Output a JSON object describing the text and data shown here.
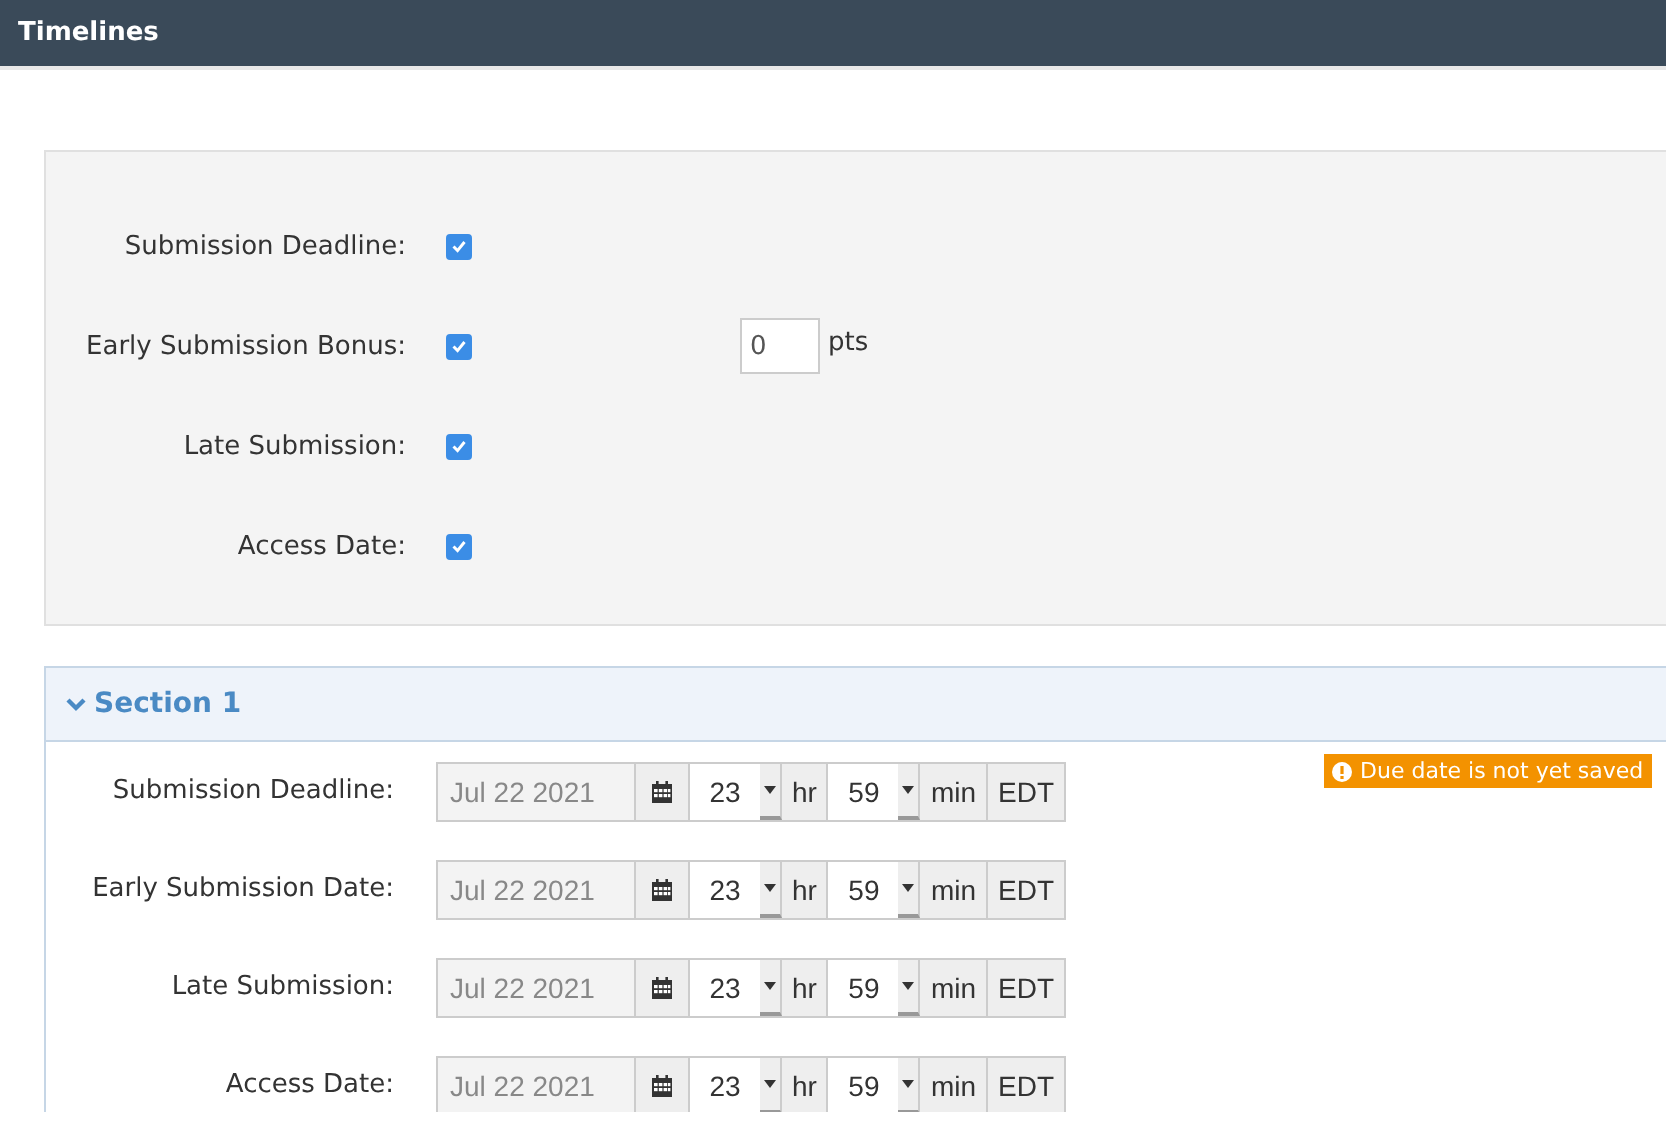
{
  "header": {
    "title": "Timelines"
  },
  "settings": [
    {
      "label": "Submission Deadline:",
      "checked": true
    },
    {
      "label": "Early Submission Bonus:",
      "checked": true,
      "bonus": {
        "value": "0",
        "unit": "pts"
      }
    },
    {
      "label": "Late Submission:",
      "checked": true
    },
    {
      "label": "Access Date:",
      "checked": true
    }
  ],
  "section": {
    "title": "Section 1",
    "expanded": true,
    "rows": [
      {
        "label": "Submission Deadline:",
        "date": "Jul 22 2021",
        "hour": "23",
        "hour_unit": "hr",
        "minute": "59",
        "minute_unit": "min",
        "zone": "EDT",
        "warning": "Due date is not yet saved"
      },
      {
        "label": "Early Submission Date:",
        "date": "Jul 22 2021",
        "hour": "23",
        "hour_unit": "hr",
        "minute": "59",
        "minute_unit": "min",
        "zone": "EDT"
      },
      {
        "label": "Late Submission:",
        "date": "Jul 22 2021",
        "hour": "23",
        "hour_unit": "hr",
        "minute": "59",
        "minute_unit": "min",
        "zone": "EDT"
      },
      {
        "label": "Access Date:",
        "date": "Jul 22 2021",
        "hour": "23",
        "hour_unit": "hr",
        "minute": "59",
        "minute_unit": "min",
        "zone": "EDT"
      }
    ]
  }
}
